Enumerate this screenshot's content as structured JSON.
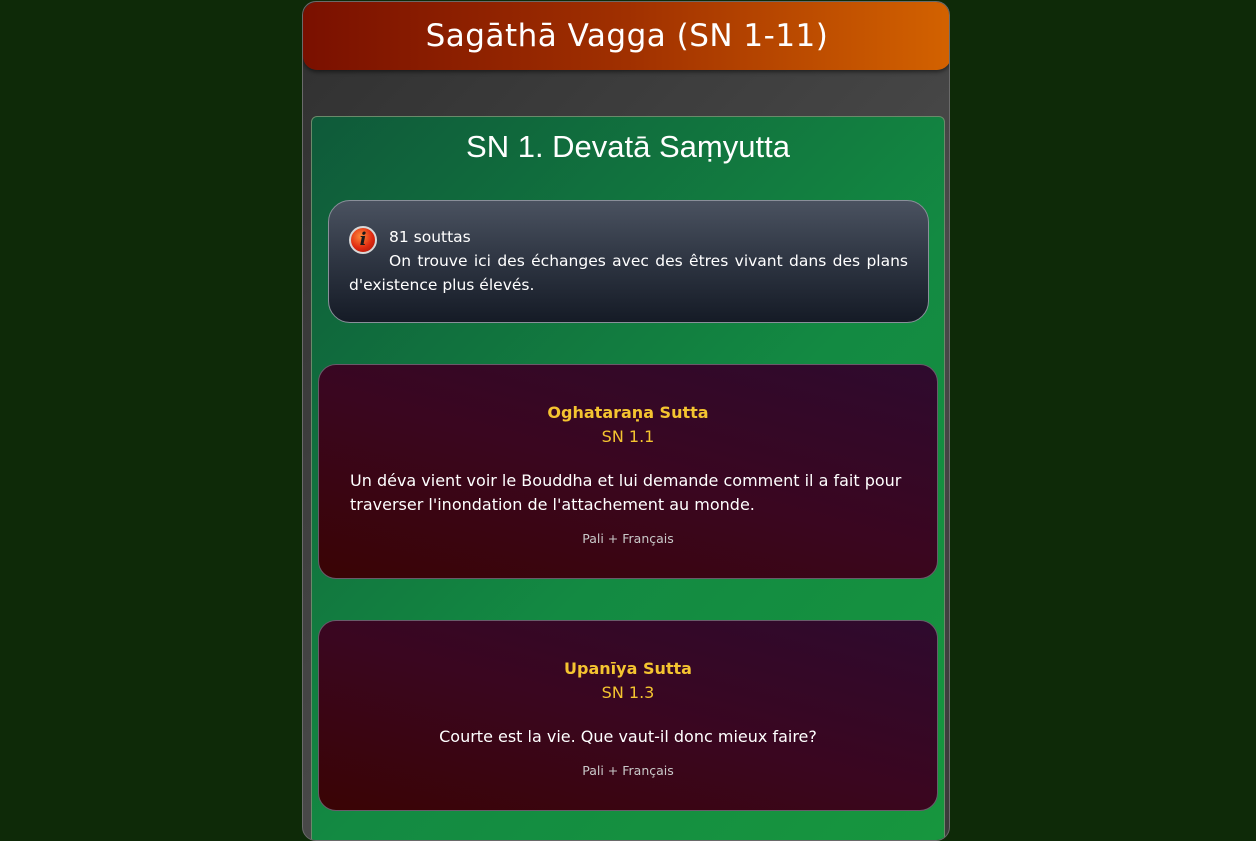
{
  "header": {
    "title": "Sagāthā Vagga (SN 1-11)"
  },
  "samyutta": {
    "title": "SN 1. Devatā Saṃyutta",
    "info": {
      "icon": "info-icon",
      "icon_glyph": "i",
      "count": "81 souttas",
      "description": "On trouve ici des échanges avec des êtres vivant dans des plans d'existence plus élevés."
    },
    "suttas": [
      {
        "name": "Oghataraṇa Sutta",
        "ref": "SN 1.1",
        "summary": "Un déva vient voir le Bouddha et lui demande comment il a fait pour traverser l'inondation de l'attachement au monde.",
        "language": "Pali + Français"
      },
      {
        "name": "Upanīya Sutta",
        "ref": "SN 1.3",
        "summary": "Courte est la vie. Que vaut-il donc mieux faire?",
        "language": "Pali + Français"
      }
    ]
  },
  "colors": {
    "background": "#0e2a08",
    "header_gradient_start": "#7a1000",
    "header_gradient_end": "#d36200",
    "samyutta_green": "#138a42",
    "sutta_title_gold": "#f4c430",
    "card_maroon": "#3a0404"
  }
}
